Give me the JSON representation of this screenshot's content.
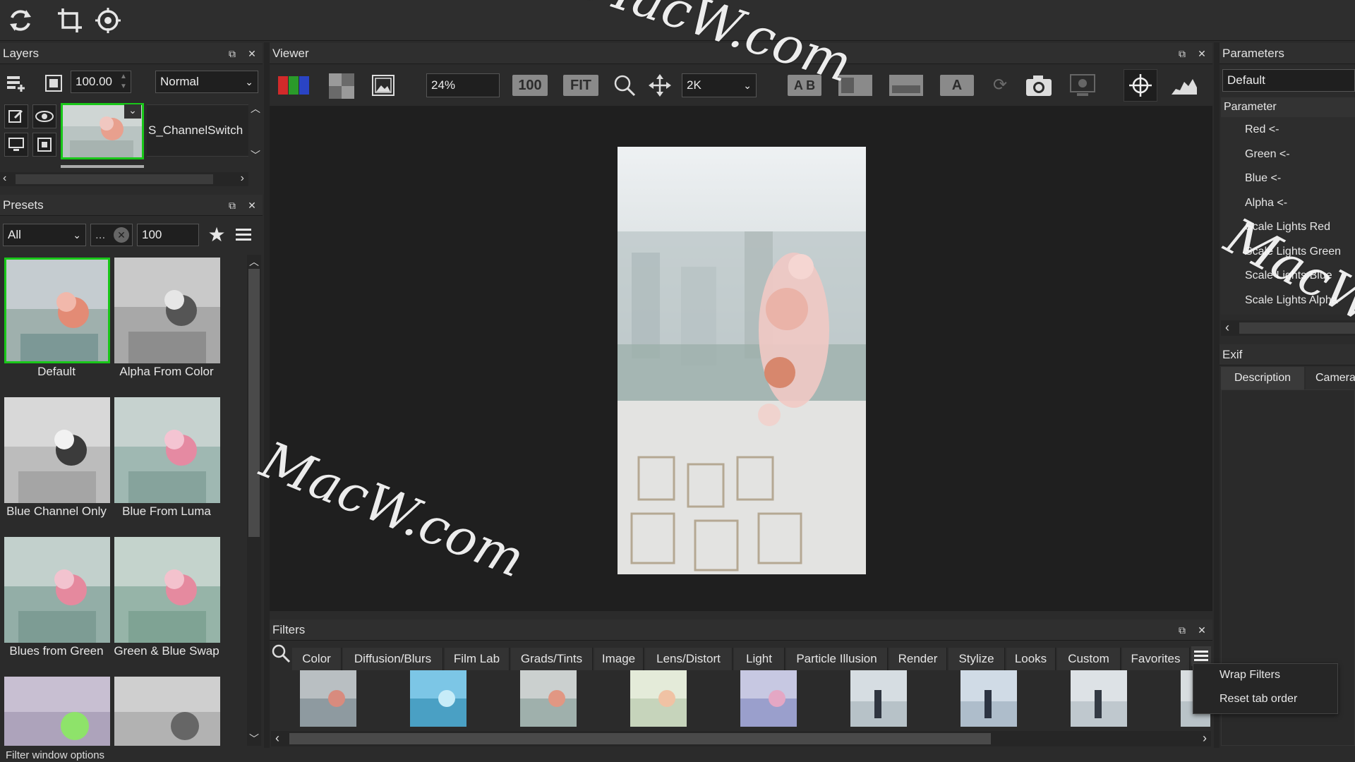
{
  "topbar": {
    "icons": [
      "refresh-icon",
      "crop-icon",
      "target-icon"
    ]
  },
  "layers": {
    "title": "Layers",
    "opacity": "100.00",
    "blend_mode": "Normal",
    "layer_name": "S_ChannelSwitch"
  },
  "presets": {
    "title": "Presets",
    "category": "All",
    "search_placeholder": "...",
    "size": "100",
    "items": [
      {
        "label": "Default"
      },
      {
        "label": "Alpha From Color"
      },
      {
        "label": "Blue Channel Only"
      },
      {
        "label": "Blue From Luma"
      },
      {
        "label": "Blues from Green"
      },
      {
        "label": "Green & Blue Swap"
      }
    ]
  },
  "viewer": {
    "title": "Viewer",
    "zoom": "24%",
    "btn_100": "100",
    "btn_fit": "FIT",
    "resolution": "2K",
    "ab_label": "A B",
    "a_label": "A"
  },
  "filters": {
    "title": "Filters",
    "tabs": [
      "Color",
      "Diffusion/Blurs",
      "Film Lab",
      "Grads/Tints",
      "Image",
      "Lens/Distort",
      "Light",
      "Particle Illusion",
      "Render",
      "Stylize",
      "Looks",
      "Custom",
      "Favorites"
    ],
    "menu": [
      "Wrap Filters",
      "Reset tab order"
    ]
  },
  "parameters": {
    "title": "Parameters",
    "preset": "Default",
    "section": "Parameter",
    "items": [
      "Red <-",
      "Green <-",
      "Blue <-",
      "Alpha <-",
      "Scale Lights Red",
      "Scale Lights Green",
      "Scale Lights Blue",
      "Scale Lights Alpha"
    ]
  },
  "exif": {
    "title": "Exif",
    "tabs": [
      "Description",
      "Camera"
    ]
  },
  "status": {
    "text": "Filter window options"
  },
  "watermark": "MacW.com",
  "colors": {
    "selection_green": "#19c719",
    "panel_bg": "#2b2b2b",
    "viewer_bg": "#1f1f1f"
  }
}
